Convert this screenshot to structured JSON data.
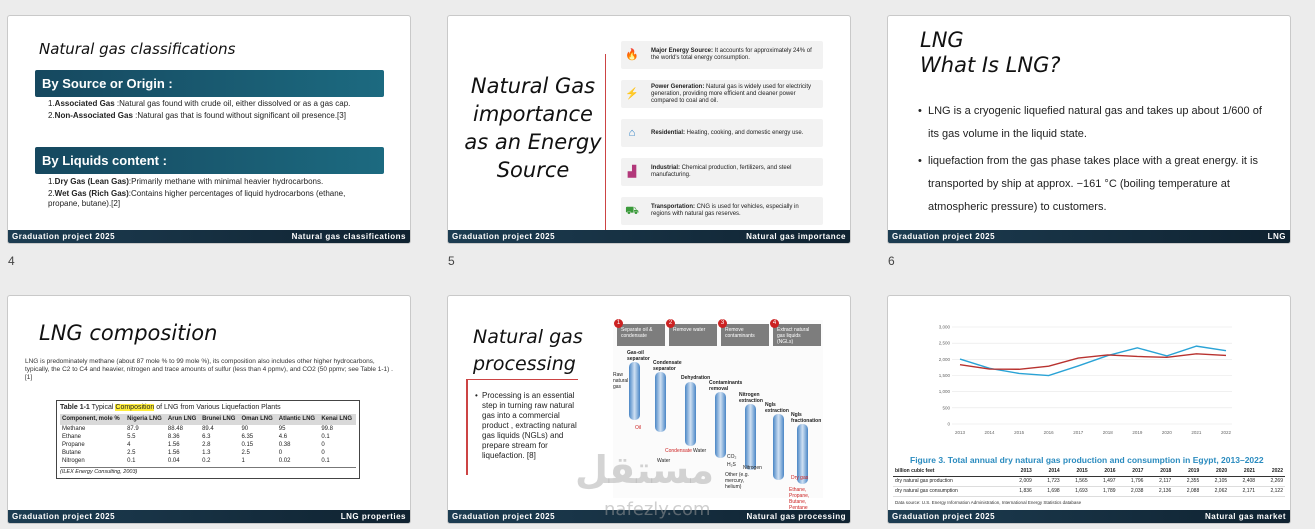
{
  "slides": [
    {
      "number": "4",
      "title": "Natural gas classifications",
      "bar1": "By Source or Origin :",
      "list1": [
        {
          "n": "1.",
          "term": "Associated Gas",
          "text": " :Natural gas found with crude oil, either dissolved or as a gas cap."
        },
        {
          "n": "2.",
          "term": "Non-Associated Gas",
          "text": " :Natural gas that is found without significant oil presence.[3]"
        }
      ],
      "bar2": "By Liquids content :",
      "list2": [
        {
          "n": "1.",
          "term": "Dry Gas (Lean Gas)",
          "text": ":Primarily methane with minimal heavier hydrocarbons."
        },
        {
          "n": "2.",
          "term": "Wet Gas (Rich Gas)",
          "text": ":Contains higher percentages of liquid hydrocarbons (ethane, propane, butane).[2]"
        }
      ],
      "footer_left": "Graduation project 2025",
      "footer_right": "Natural gas classifications"
    },
    {
      "number": "5",
      "title": "Natural Gas importance as an Energy Source",
      "cards": [
        {
          "icon": "gas-flame-icon",
          "glyph": "🔥",
          "term": "Major Energy Source:",
          "text": " It accounts for approximately 24% of the world's total energy consumption."
        },
        {
          "icon": "windmill-icon",
          "glyph": "⚡",
          "term": "Power Generation:",
          "text": " Natural gas is widely used for electricity generation, providing more efficient and cleaner power compared to coal and oil."
        },
        {
          "icon": "house-icon",
          "glyph": "⌂",
          "term": "Residential:",
          "text": " Heating, cooking, and domestic energy use."
        },
        {
          "icon": "factory-icon",
          "glyph": "▟",
          "term": "Industrial:",
          "text": " Chemical production, fertilizers, and steel manufacturing."
        },
        {
          "icon": "car-icon",
          "glyph": "⛟",
          "term": "Transportation:",
          "text": " CNG is used for vehicles, especially in regions with natural gas reserves."
        }
      ],
      "footer_left": "Graduation project 2025",
      "footer_right": "Natural gas importance"
    },
    {
      "number": "6",
      "title_line1": "LNG",
      "title_line2": "What Is LNG?",
      "bullets": [
        "LNG is a cryogenic liquefied natural gas and takes up about 1/600 of its gas volume in the liquid state.",
        "liquefaction from the gas phase takes place with a great energy. it is transported by ship at approx. −161 °C (boiling temperature at atmospheric pressure) to customers."
      ],
      "footer_left": "Graduation project 2025",
      "footer_right": "LNG"
    },
    {
      "title": "LNG composition",
      "paragraph": "LNG is predominately methane (about 87 mole % to 99 mole %), its composition also includes other higher hydrocarbons, typically, the C2 to C4 and heavier, nitrogen and trace amounts of sulfur (less than 4 ppmv), and CO2 (50 ppmv; see Table 1-1) .[1]",
      "table_caption_pre": "Table 1-1",
      "table_caption_mid": "  Typical ",
      "table_caption_hl": "Composition",
      "table_caption_post": " of LNG from Various Liquefaction Plants",
      "table_headers": [
        "Component, mole %",
        "Nigeria LNG",
        "Arun LNG",
        "Brunei LNG",
        "Oman LNG",
        "Atlantic LNG",
        "Kenai LNG"
      ],
      "table_rows": [
        [
          "Methane",
          "87.9",
          "88.48",
          "89.4",
          "90",
          "95",
          "99.8"
        ],
        [
          "Ethane",
          "5.5",
          "8.36",
          "6.3",
          "6.35",
          "4.6",
          "0.1"
        ],
        [
          "Propane",
          "4",
          "1.56",
          "2.8",
          "0.15",
          "0.38",
          "0"
        ],
        [
          "Butane",
          "2.5",
          "1.56",
          "1.3",
          "2.5",
          "0",
          "0"
        ],
        [
          "Nitrogen",
          "0.1",
          "0.04",
          "0.2",
          "1",
          "0.02",
          "0.1"
        ]
      ],
      "table_source": "(ILEX Energy Consulting, 2003)",
      "footer_left": "Graduation project 2025",
      "footer_right": "LNG properties"
    },
    {
      "title_line1": "Natural gas",
      "title_line2": "processing",
      "bullet": "Processing is an essential step in turning raw natural gas into a commercial product , extracting natural gas liquids (NGLs) and prepare stream for liquefaction. [8]",
      "steps": [
        {
          "n": "1",
          "label": "Separate oil & condensate"
        },
        {
          "n": "2",
          "label": "Remove water"
        },
        {
          "n": "3",
          "label": "Remove contaminants"
        },
        {
          "n": "4",
          "label": "Extract natural gas liquids (NGLs)"
        }
      ],
      "diagram_labels": [
        "Gas-oil separator",
        "Condensate separator",
        "Dehydration",
        "Contaminants removal",
        "Nitrogen extraction",
        "Ngls extraction",
        "Ngls fractionation",
        "Raw natural gas",
        "Oil",
        "Condensate",
        "Water",
        "Water",
        "CO₂",
        "H₂S",
        "Nitrogen",
        "Other (e.g. mercury, helium)",
        "Dry gas",
        "Ethane, Propane, Butane, Pentane"
      ],
      "footer_left": "Graduation project 2025",
      "footer_right": "Natural gas processing"
    },
    {
      "figure_title": "Figure 3. Total annual dry natural gas production and consumption in Egypt, 2013–2022",
      "table_header": [
        "billion cubic feet",
        "2013",
        "2014",
        "2015",
        "2016",
        "2017",
        "2018",
        "2019",
        "2020",
        "2021",
        "2022"
      ],
      "table_rows": [
        [
          "dry natural gas production",
          "2,009",
          "1,723",
          "1,565",
          "1,497",
          "1,796",
          "2,117",
          "2,355",
          "2,105",
          "2,408",
          "2,269"
        ],
        [
          "dry natural gas consumption",
          "1,836",
          "1,698",
          "1,693",
          "1,789",
          "2,038",
          "2,136",
          "2,088",
          "2,062",
          "2,171",
          "2,122"
        ]
      ],
      "data_source": "Data source: U.S. Energy Information Administration, International Energy Statistics database",
      "footer_left": "Graduation project 2025",
      "footer_right": "Natural gas market"
    }
  ],
  "chart_data": {
    "type": "line",
    "title": "Figure 3. Total annual dry natural gas production and consumption in Egypt, 2013–2022",
    "x": [
      2013,
      2014,
      2015,
      2016,
      2017,
      2018,
      2019,
      2020,
      2021,
      2022
    ],
    "ylim": [
      0,
      3000
    ],
    "yticks": [
      "0",
      "500",
      "1,000",
      "1,500",
      "2,000",
      "2,500",
      "3,000"
    ],
    "grid": true,
    "series": [
      {
        "values": [
          2009,
          1723,
          1565,
          1497,
          1796,
          2117,
          2355,
          2105,
          2408,
          2269
        ],
        "color": "#2aa3d6"
      },
      {
        "values": [
          1836,
          1698,
          1693,
          1789,
          2038,
          2136,
          2088,
          2062,
          2171,
          2122
        ],
        "color": "#b8322f"
      }
    ]
  },
  "watermark": "مستقل",
  "watermark_url": "nafezly.com"
}
